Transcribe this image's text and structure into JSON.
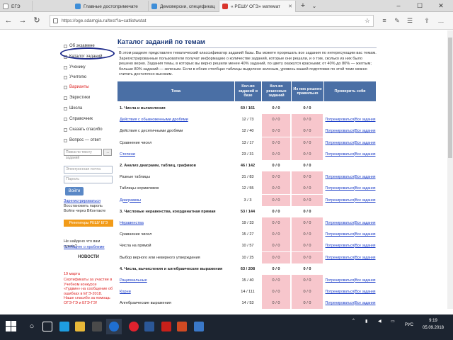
{
  "browser": {
    "tabs": [
      {
        "label": "ЕГЭ",
        "color": "#ffffff",
        "active": false
      },
      {
        "label": "Главные достопримечате",
        "color": "#3e8ed8",
        "active": false
      },
      {
        "label": "Демоверсии, спецификац",
        "color": "#3e8ed8",
        "active": false
      },
      {
        "label": "« РЕШУ ОГЭ» математ",
        "color": "#d9342b",
        "active": true
      }
    ],
    "url": "https://oge.sdamgia.ru/test?a=catlistwstat"
  },
  "sidebar": {
    "items": [
      {
        "label": "Об экзамене",
        "red": false
      },
      {
        "label": "Каталог заданий",
        "red": false
      },
      {
        "label": "Ученику",
        "red": false
      },
      {
        "label": "Учителю",
        "red": false
      },
      {
        "label": "Варианты",
        "red": true
      },
      {
        "label": "Эвристики",
        "red": false
      },
      {
        "label": "Школа",
        "red": false
      },
      {
        "label": "Справочник",
        "red": false
      },
      {
        "label": "Сказать спасибо",
        "red": false
      },
      {
        "label": "Вопрос — ответ",
        "red": false
      }
    ],
    "search_placeholder": "Поиск по тексту заданий",
    "login_placeholder": "Электронная почта",
    "password_placeholder": "Пароль",
    "enter_label": "Войти",
    "register_link": "Зарегистрироваться",
    "restore_link": "Восстановить пароль",
    "vk_link": "Войти через ВКонтакте",
    "promo_label": "Репетиторы РЕШУ ЕГЭ",
    "help_text": "Не найдено что вам нужно?",
    "help_link": "Сообщите о проблеме",
    "news_title": "НОВОСТИ",
    "news_date": "19 марта",
    "news_text": "Сертификаты за участие в Учебном конкурсе «Гудвин» на сообщение об ошибках в ЕГЭ-2018. Наше спасибо за помощь ОГЭ-ГЭ и ЕГЭ-ГЭ!"
  },
  "main": {
    "title": "Каталог заданий по темам",
    "intro": "В этом разделе представлен тематический классификатор заданий базы. Вы можете прорешать все задания по интересующим вас темам. Зарегистрированные пользователи получат информацию о количестве заданий, которые они решали, и о том, сколько из них было решено верно. Задания темы, в которых вы верно решили менее 40% заданий, по цвету окажутся красными; от 40% до 80% — желтым; больше 80% заданий — зеленым. Если в обоих столбцах таблицы выделено зеленым, уровень вашей подготовки по этой теме можно считать достаточно высоким.",
    "columns": {
      "topic": "Тема",
      "count": "Кол-во заданий в базе",
      "solved": "Кол-во решенных заданий",
      "correct": "Из них решено правильно",
      "check": "Проверить себя"
    },
    "check_labels": {
      "train": "Потренироваться",
      "all": "Все задания"
    },
    "rows": [
      {
        "topic": "1. Числа и вычисления",
        "count": "60 / 161",
        "solved": "0 / 0",
        "correct": "0 / 0",
        "section": true,
        "link": false
      },
      {
        "topic": "Действия с обыкновенными дробями",
        "count": "12 / 73",
        "solved": "0 / 0",
        "correct": "0 / 0",
        "section": false,
        "link": true
      },
      {
        "topic": "Действия с десятичными дробями",
        "count": "12 / 40",
        "solved": "0 / 0",
        "correct": "0 / 0",
        "section": false,
        "link": false
      },
      {
        "topic": "Сравнение чисел",
        "count": "13 / 17",
        "solved": "0 / 0",
        "correct": "0 / 0",
        "section": false,
        "link": false
      },
      {
        "topic": "Степени",
        "count": "23 / 31",
        "solved": "0 / 0",
        "correct": "0 / 0",
        "section": false,
        "link": true
      },
      {
        "topic": "2. Анализ диаграмм, таблиц, графиков",
        "count": "46 / 142",
        "solved": "0 / 0",
        "correct": "0 / 0",
        "section": true,
        "link": false
      },
      {
        "topic": "Разные таблицы",
        "count": "31 / 83",
        "solved": "0 / 0",
        "correct": "0 / 0",
        "section": false,
        "link": false
      },
      {
        "topic": "Таблицы нормативов",
        "count": "12 / 55",
        "solved": "0 / 0",
        "correct": "0 / 0",
        "section": false,
        "link": false
      },
      {
        "topic": "Диаграммы",
        "count": "3 / 3",
        "solved": "0 / 0",
        "correct": "0 / 0",
        "section": false,
        "link": true
      },
      {
        "topic": "3. Числовые неравенства, координатная прямая",
        "count": "53 / 144",
        "solved": "0 / 0",
        "correct": "0 / 0",
        "section": true,
        "link": false
      },
      {
        "topic": "Неравенства",
        "count": "19 / 33",
        "solved": "0 / 0",
        "correct": "0 / 0",
        "section": false,
        "link": true
      },
      {
        "topic": "Сравнение чисел",
        "count": "15 / 27",
        "solved": "0 / 0",
        "correct": "0 / 0",
        "section": false,
        "link": false
      },
      {
        "topic": "Числа на прямой",
        "count": "10 / 57",
        "solved": "0 / 0",
        "correct": "0 / 0",
        "section": false,
        "link": false
      },
      {
        "topic": "Выбор верного или неверного утверждения",
        "count": "10 / 25",
        "solved": "0 / 0",
        "correct": "0 / 0",
        "section": false,
        "link": false
      },
      {
        "topic": "4. Числа, вычисления и алгебраические выражения",
        "count": "63 / 208",
        "solved": "0 / 0",
        "correct": "0 / 0",
        "section": true,
        "link": false
      },
      {
        "topic": "Рациональные",
        "count": "15 / 40",
        "solved": "0 / 0",
        "correct": "0 / 0",
        "section": false,
        "link": true
      },
      {
        "topic": "Корни",
        "count": "14 / 111",
        "solved": "0 / 0",
        "correct": "0 / 0",
        "section": false,
        "link": true
      },
      {
        "topic": "Алгебраические выражения",
        "count": "14 / 53",
        "solved": "0 / 0",
        "correct": "0 / 0",
        "section": false,
        "link": false
      }
    ]
  },
  "taskbar": {
    "lang": "РУС",
    "time": "9:19",
    "date": "05.09.2018"
  }
}
